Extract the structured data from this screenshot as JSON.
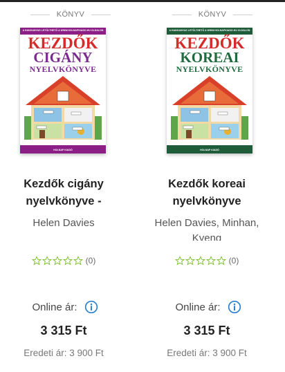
{
  "products": [
    {
      "type_label": "KÖNYV",
      "cover": {
        "tagline": "A HANGANYAG LETÖLTHETŐ A WWW.HOLNAPKIADO.HU OLDALON",
        "line1": "KEZDŐK",
        "line2": "CIGÁNY",
        "line3": "NYELVKÖNYVE",
        "publisher": "HOLNAP KIADÓ",
        "accent_color": "#8c1f86"
      },
      "title": "Kezdők cigány nyelvkönyve -",
      "author": "Helen Davies",
      "rating_stars": 0,
      "rating_count": "(0)",
      "online_label": "Online ár:",
      "price": "3 315 Ft",
      "original_price": "Eredeti ár: 3 900 Ft"
    },
    {
      "type_label": "KÖNYV",
      "cover": {
        "tagline": "A HANGANYAG LETÖLTHETŐ A WWW.HOLNAPKIADO.HU OLDALON",
        "line1": "KEZDŐK",
        "line2": "KOREAI",
        "line3": "NYELVKÖNYVE",
        "publisher": "HOLNAP KIADÓ",
        "accent_color": "#1f5c3a"
      },
      "title": "Kezdők koreai nyelvkönyve",
      "author": "Helen Davies, Minhan, Kyeng",
      "rating_stars": 0,
      "rating_count": "(0)",
      "online_label": "Online ár:",
      "price": "3 315 Ft",
      "original_price": "Eredeti ár: 3 900 Ft"
    }
  ],
  "colors": {
    "star_outline": "#7cbf2e",
    "info_icon": "#2b7fd0"
  }
}
